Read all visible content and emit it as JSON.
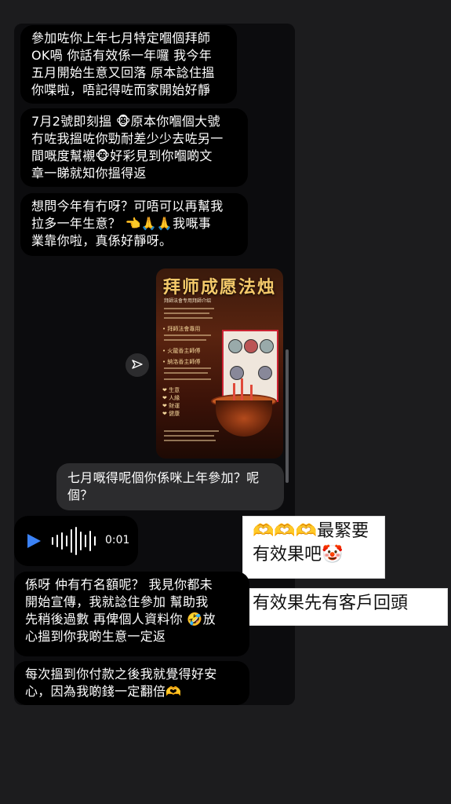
{
  "messages": [
    {
      "text": "參加咗你上年七月特定嗰個拜師\nOK喎 你話有效係一年囉 我今年\n五月開始生意又回落 原本諗住搵\n你喋啦，唔記得咗而家開始好靜"
    },
    {
      "text": "7月2號即刻搵 🐵原本你嗰個大號\n冇咗我搵咗你勁耐差少少去咗另一\n間嘅度幫襯🐵好彩見到你嗰啲文\n章一睇就知你搵得返"
    },
    {
      "text": "想問今年有冇呀？可唔可以再幫我\n拉多一年生意？ 👈🙏🙏我嘅事\n業靠你啦，真係好靜呀。"
    },
    {
      "text": "七月嘅得呢個你係咪上年參加？呢\n個？"
    },
    {
      "text": "係呀 仲有冇名額呢？ 我見你都未\n開始宣傳，我就諗住參加 幫助我\n先稍後過數 再俾個人資料你 🤣放\n心搵到你我啲生意一定返"
    },
    {
      "text": "每次搵到你付款之後我就覺得好安\n心，因為我啲錢一定翻倍🫶"
    }
  ],
  "card": {
    "title": "拜师成愿法烛",
    "subtitle": "拜師法會专用拜師介绍",
    "bullets": [
      "• 拜師法會專用",
      "• 火龍香主師傅",
      "• 納洛香主師傅",
      "❤ 生意",
      "❤ 人緣",
      "❤ 財運",
      "❤ 健康"
    ]
  },
  "voice": {
    "duration": "0:01"
  },
  "stickers": [
    {
      "text": "🫶🫶🫶最緊要\n有效果吧🤡"
    },
    {
      "text": "有效果先有客戶回頭"
    }
  ],
  "icons": {
    "share": "send-icon",
    "play": "play-icon"
  }
}
